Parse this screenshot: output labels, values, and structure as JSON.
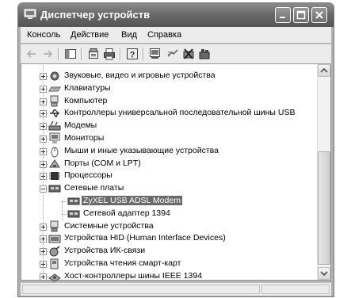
{
  "window": {
    "title": "Диспетчер устройств",
    "icon": "device-manager-icon"
  },
  "menu": [
    "Консоль",
    "Действие",
    "Вид",
    "Справка"
  ],
  "toolbar": {
    "icons": [
      "back-icon",
      "forward-icon",
      "console-tree-icon",
      "properties-icon",
      "print-icon",
      "help-icon",
      "scan-hardware-icon",
      "update-driver-icon",
      "disable-icon",
      "uninstall-icon"
    ]
  },
  "tree": {
    "items": [
      {
        "label": "Звуковые, видео и игровые устройства",
        "icon": "sound-icon",
        "expandable": true
      },
      {
        "label": "Клавиатуры",
        "icon": "keyboard-icon",
        "expandable": true
      },
      {
        "label": "Компьютер",
        "icon": "computer-icon",
        "expandable": true
      },
      {
        "label": "Контроллеры универсальной последовательной шины USB",
        "icon": "usb-icon",
        "expandable": true
      },
      {
        "label": "Модемы",
        "icon": "modem-icon",
        "expandable": true
      },
      {
        "label": "Мониторы",
        "icon": "monitor-icon",
        "expandable": true
      },
      {
        "label": "Мыши и иные указывающие устройства",
        "icon": "mouse-icon",
        "expandable": true
      },
      {
        "label": "Порты (COM и LPT)",
        "icon": "port-icon",
        "expandable": true
      },
      {
        "label": "Процессоры",
        "icon": "cpu-icon",
        "expandable": true
      },
      {
        "label": "Сетевые платы",
        "icon": "network-adapter-icon",
        "expandable": true,
        "expanded": true
      },
      {
        "label": "ZyXEL USB ADSL Modem",
        "icon": "network-adapter-icon",
        "child": true,
        "selected": true
      },
      {
        "label": "Сетевой адаптер 1394",
        "icon": "network-adapter-icon",
        "child": true
      },
      {
        "label": "Системные устройства",
        "icon": "system-device-icon",
        "expandable": true
      },
      {
        "label": "Устройства HID (Human Interface Devices)",
        "icon": "hid-icon",
        "expandable": true
      },
      {
        "label": "Устройства ИК-связи",
        "icon": "infrared-icon",
        "expandable": true
      },
      {
        "label": "Устройства чтения смарт-карт",
        "icon": "smartcard-reader-icon",
        "expandable": true
      },
      {
        "label": "Хост-контроллеры шины IEEE 1394",
        "icon": "ieee1394-icon",
        "expandable": true
      }
    ]
  }
}
